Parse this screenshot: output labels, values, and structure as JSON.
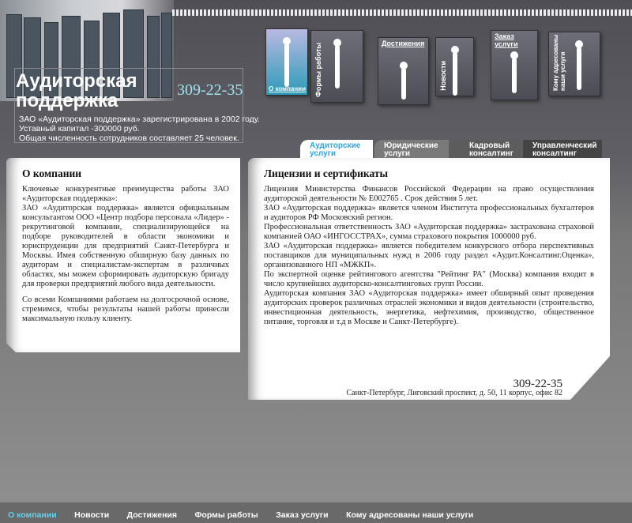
{
  "header": {
    "logo_line1": "Аудиторская",
    "logo_line2": "поддержка",
    "phone": "309-22-35",
    "intro": [
      "ЗАО «Аудиторская поддержка» зарегистрирована в 2002 году.",
      "Уставный капитал -300000 руб.",
      "Общая численность сотрудников составляет 25 человек."
    ]
  },
  "nav_cards": [
    {
      "label": "О компании",
      "active": true
    },
    {
      "label": "Формы работы"
    },
    {
      "label": "Достижения"
    },
    {
      "label": "Новости"
    },
    {
      "label": "Заказ услуги"
    },
    {
      "label": "Кому адресованы наши услуги"
    }
  ],
  "tabs": [
    {
      "label": "Аудиторские услуги",
      "active": true
    },
    {
      "label": "Юридические услуги"
    },
    {
      "label": "Кадровый консалтинг"
    },
    {
      "label": "Управленческий консалтинг"
    }
  ],
  "left": {
    "title": "О компании",
    "paragraphs": [
      "Ключевые конкурентные преимущества работы ЗАО «Аудиторская поддержка»:",
      "ЗАО «Аудиторская поддержка» является официальным консультантом ООО «Центр подбора персонала «Лидер» - рекрутинговой компании, специализирующейся на подборе руководителей в области экономики и юриспруденции для предприятий Санкт-Петербурга и Москвы. Имея собственную обширную базу данных по аудиторам и специалистам-экспертам в различных областях, мы можем сформировать аудиторскую бригаду для проверки предприятий любого вида деятельности.",
      "Со всеми Компаниями работаем на долгосрочной основе, стремимся, чтобы результаты нашей работы принесли максимальную пользу клиенту."
    ]
  },
  "right": {
    "title": "Лицензии и сертификаты",
    "paragraphs": [
      "Лицензия Министерства Финансов Российской Федерации на право осуществления аудиторской деятельности № Е002765 . Срок действия 5 лет.",
      "ЗАО «Аудиторская поддержка» является членом Института профессиональных бухгалтеров и аудиторов РФ Московский регион.",
      "Профессиональная ответственность ЗАО «Аудиторская поддержка» застрахована страховой компанией ОАО «ИНГОССТРАХ», сумма страхового покрытия 1000000 руб.",
      "ЗАО «Аудиторская поддержка» является победителем конкурсного отбора перспективных поставщиков для муниципальных нужд в 2006 году раздел «Аудит.Консалтинг.Оценка», организованного НП «МЖКП».",
      "По экспертной оценке рейтингового агентства \"Рейтинг РА\" (Москва) компания входит в число крупнейших аудиторско-консалтинговых групп России.",
      "Аудиторская компания ЗАО «Аудиторская поддержка» имеет обширный опыт проведения аудиторских проверок различных отраслей экономики и видов деятельности (строительство, инвестиционная деятельность, энергетика, нефтехимия, производство, общественное питание, торговля и т.д в Москве и Санкт-Петербурге)."
    ],
    "phone": "309-22-35",
    "address": "Санкт-Петербург, Лиговский проспект, д. 50, 11 корпус, офис 82"
  },
  "footer": [
    "О компании",
    "Новости",
    "Достижения",
    "Формы работы",
    "Заказ услуги",
    "Кому адресованы наши услуги"
  ],
  "colors": {
    "accent": "#49c3e6",
    "footer_active": "#5fd4f0"
  }
}
